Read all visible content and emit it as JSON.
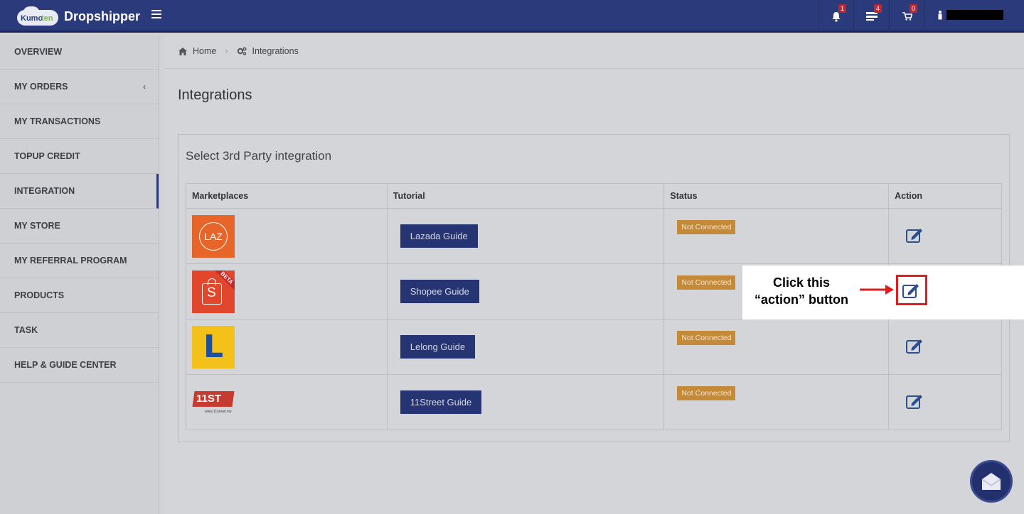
{
  "app": {
    "logo_part1": "Kumo",
    "logo_part2": "ten",
    "name": "Dropshipper"
  },
  "topbar": {
    "notifications_count": "1",
    "messages_count": "4",
    "cart_count": "0"
  },
  "sidebar": {
    "items": [
      {
        "label": "OVERVIEW"
      },
      {
        "label": "MY ORDERS"
      },
      {
        "label": "MY TRANSACTIONS"
      },
      {
        "label": "TOPUP CREDIT"
      },
      {
        "label": "INTEGRATION"
      },
      {
        "label": "MY STORE"
      },
      {
        "label": "MY REFERRAL PROGRAM"
      },
      {
        "label": "PRODUCTS"
      },
      {
        "label": "TASK"
      },
      {
        "label": "HELP & GUIDE CENTER"
      }
    ],
    "active": "INTEGRATION"
  },
  "breadcrumb": {
    "home": "Home",
    "current": "Integrations"
  },
  "page": {
    "title": "Integrations",
    "panel_title": "Select 3rd Party integration"
  },
  "table": {
    "headers": [
      "Marketplaces",
      "Tutorial",
      "Status",
      "Action"
    ],
    "rows": [
      {
        "marketplace": "LAZ",
        "guide": "Lazada Guide",
        "status": "Not Connected"
      },
      {
        "marketplace": "S",
        "guide": "Shopee Guide",
        "status": "Not Connected",
        "logo_tag": "BETA"
      },
      {
        "marketplace": "L",
        "guide": "Lelong Guide",
        "status": "Not Connected"
      },
      {
        "marketplace": "11ST",
        "guide": "11Street Guide",
        "status": "Not Connected",
        "logo_sub": "www.11street.my"
      }
    ]
  },
  "callout": {
    "line1": "Click this",
    "line2": "“action” button"
  },
  "colors": {
    "topbar": "#2b3a7a",
    "button": "#263474",
    "status": "#c58a38",
    "highlight": "#e01c1c"
  }
}
